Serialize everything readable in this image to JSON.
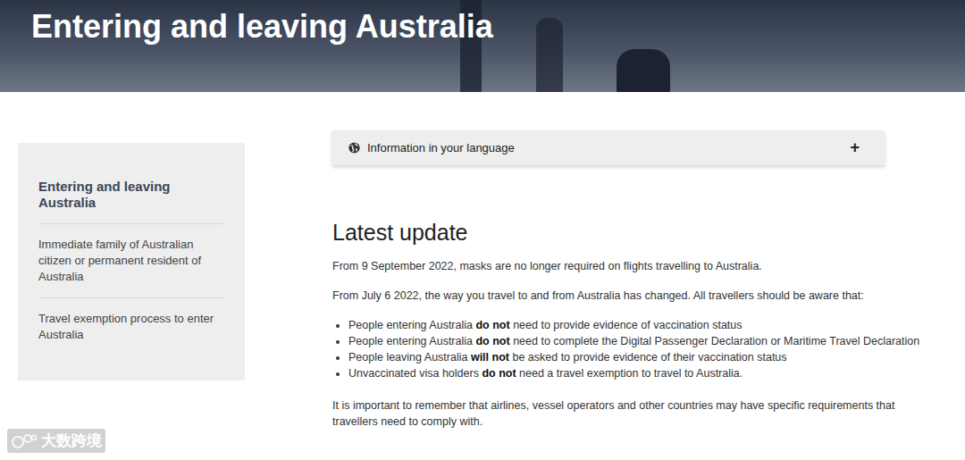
{
  "header": {
    "title": "Entering and leaving Australia"
  },
  "sidebar": {
    "items": [
      {
        "label": "Entering and leaving Australia",
        "selected": true
      },
      {
        "label": "Immediate family of Australian citizen or permanent resident of Australia",
        "selected": false
      },
      {
        "label": "Travel exemption process to enter Australia",
        "selected": false
      }
    ]
  },
  "accordion": {
    "label": "Information in your language",
    "toggle": "+",
    "expanded": false
  },
  "content": {
    "heading": "Latest update",
    "intro": [
      "From 9 September 2022, masks are no longer required on flights travelling to Australia.",
      "From July 6 2022, the way you travel to and from Australia has changed. All travellers should be aware that:"
    ],
    "list": [
      [
        {
          "text": "People entering Australia ",
          "bold": false
        },
        {
          "text": "do not",
          "bold": true
        },
        {
          "text": " need to provide evidence of vaccination status",
          "bold": false
        }
      ],
      [
        {
          "text": "People entering Australia ",
          "bold": false
        },
        {
          "text": "do not",
          "bold": true
        },
        {
          "text": " need to complete the Digital Passenger Declaration or Maritime Travel Declaration",
          "bold": false
        }
      ],
      [
        {
          "text": "People leaving Australia ",
          "bold": false
        },
        {
          "text": "will not",
          "bold": true
        },
        {
          "text": " be asked to provide evidence of their vaccination status",
          "bold": false
        }
      ],
      [
        {
          "text": "Unvaccinated visa holders ",
          "bold": false
        },
        {
          "text": "do not",
          "bold": true
        },
        {
          "text": " need a travel exemption to travel to Australia.",
          "bold": false
        }
      ]
    ],
    "note": "It is important to remember that airlines, vessel operators and other countries may have specific requirements that travellers need to comply with."
  },
  "watermark": {
    "text": "大数跨境"
  }
}
